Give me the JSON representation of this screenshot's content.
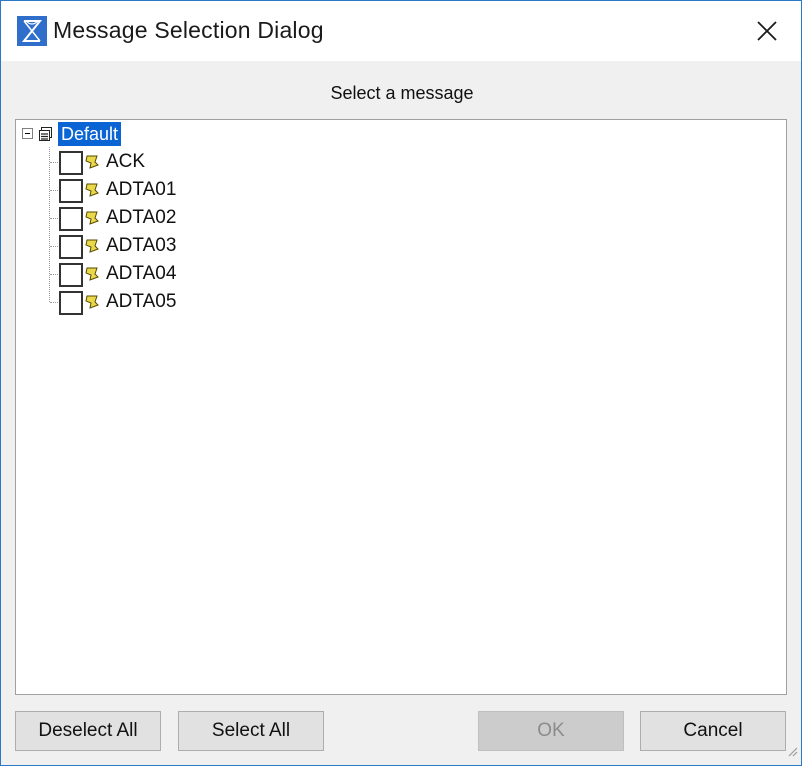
{
  "window": {
    "title": "Message Selection Dialog",
    "icon": "app-logo-icon",
    "close_icon": "close-icon"
  },
  "dialog": {
    "prompt": "Select a message"
  },
  "tree": {
    "root": {
      "label": "Default",
      "expanded": true,
      "selected": true,
      "icon": "package-icon"
    },
    "items": [
      {
        "label": "ACK",
        "checked": false,
        "icon": "message-icon"
      },
      {
        "label": "ADTA01",
        "checked": false,
        "icon": "message-icon"
      },
      {
        "label": "ADTA02",
        "checked": false,
        "icon": "message-icon"
      },
      {
        "label": "ADTA03",
        "checked": false,
        "icon": "message-icon"
      },
      {
        "label": "ADTA04",
        "checked": false,
        "icon": "message-icon"
      },
      {
        "label": "ADTA05",
        "checked": false,
        "icon": "message-icon"
      }
    ]
  },
  "buttons": {
    "deselect_all": "Deselect All",
    "select_all": "Select All",
    "ok": "OK",
    "cancel": "Cancel"
  },
  "colors": {
    "selection": "#0a64d4",
    "window_border": "#2b78c9",
    "app_icon": "#2f6fcb"
  }
}
